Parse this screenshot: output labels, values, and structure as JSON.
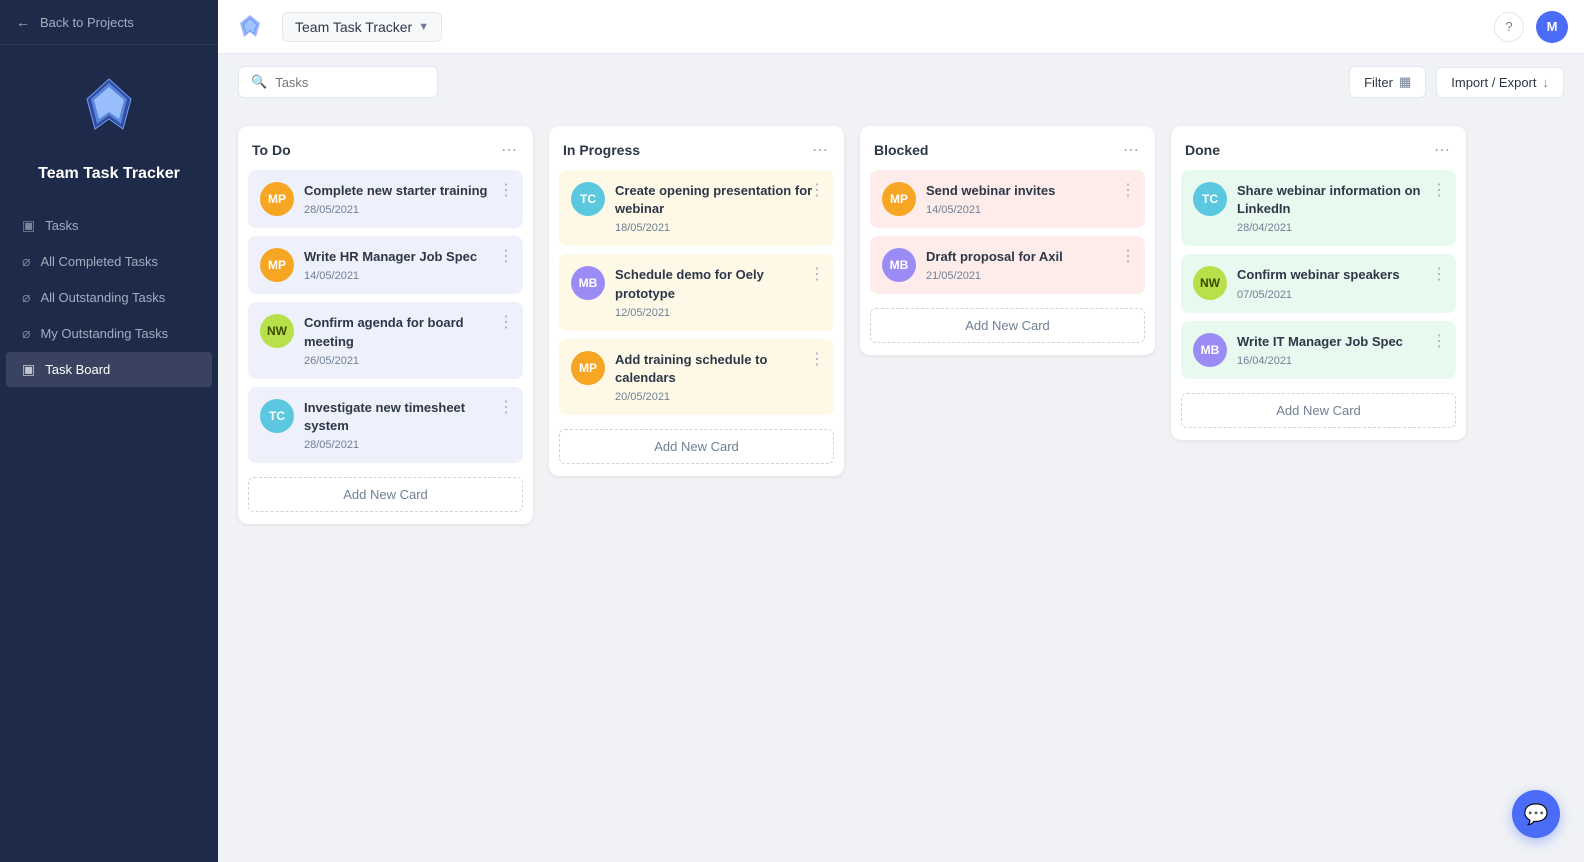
{
  "sidebar": {
    "back_label": "Back to Projects",
    "project_title": "Team Task Tracker",
    "nav_items": [
      {
        "id": "tasks",
        "label": "Tasks",
        "icon": "▦",
        "active": false
      },
      {
        "id": "all-completed",
        "label": "All Completed Tasks",
        "icon": "⌀",
        "active": false
      },
      {
        "id": "all-outstanding",
        "label": "All Outstanding Tasks",
        "icon": "⌀",
        "active": false
      },
      {
        "id": "my-outstanding",
        "label": "My Outstanding Tasks",
        "icon": "⌀",
        "active": false
      },
      {
        "id": "task-board",
        "label": "Task Board",
        "icon": "▦",
        "active": true
      }
    ]
  },
  "topbar": {
    "project_name": "Team Task Tracker",
    "help_label": "?",
    "user_initial": "M",
    "search_placeholder": "Tasks"
  },
  "toolbar": {
    "filter_label": "Filter",
    "import_export_label": "Import / Export"
  },
  "columns": [
    {
      "id": "todo",
      "title": "To Do",
      "theme": "todo",
      "cards": [
        {
          "id": "c1",
          "avatar": "MP",
          "avatar_class": "avatar-mp",
          "title": "Complete new starter training",
          "date": "28/05/2021"
        },
        {
          "id": "c2",
          "avatar": "MP",
          "avatar_class": "avatar-mp",
          "title": "Write HR Manager Job Spec",
          "date": "14/05/2021"
        },
        {
          "id": "c3",
          "avatar": "NW",
          "avatar_class": "avatar-nw",
          "title": "Confirm agenda for board meeting",
          "date": "26/05/2021"
        },
        {
          "id": "c4",
          "avatar": "TC",
          "avatar_class": "avatar-tc",
          "title": "Investigate new timesheet system",
          "date": "28/05/2021"
        }
      ],
      "add_label": "Add New Card"
    },
    {
      "id": "inprogress",
      "title": "In Progress",
      "theme": "inprogress",
      "cards": [
        {
          "id": "c5",
          "avatar": "TC",
          "avatar_class": "avatar-tc",
          "title": "Create opening presentation for webinar",
          "date": "18/05/2021"
        },
        {
          "id": "c6",
          "avatar": "MB",
          "avatar_class": "avatar-mb",
          "title": "Schedule demo for Oely prototype",
          "date": "12/05/2021"
        },
        {
          "id": "c7",
          "avatar": "MP",
          "avatar_class": "avatar-mp",
          "title": "Add training schedule to calendars",
          "date": "20/05/2021"
        }
      ],
      "add_label": "Add New Card"
    },
    {
      "id": "blocked",
      "title": "Blocked",
      "theme": "blocked",
      "cards": [
        {
          "id": "c8",
          "avatar": "MP",
          "avatar_class": "avatar-mp",
          "title": "Send webinar invites",
          "date": "14/05/2021"
        },
        {
          "id": "c9",
          "avatar": "MB",
          "avatar_class": "avatar-mb",
          "title": "Draft proposal for Axil",
          "date": "21/05/2021"
        }
      ],
      "add_label": "Add New Card"
    },
    {
      "id": "done",
      "title": "Done",
      "theme": "done",
      "cards": [
        {
          "id": "c10",
          "avatar": "TC",
          "avatar_class": "avatar-tc",
          "title": "Share webinar information on LinkedIn",
          "date": "28/04/2021"
        },
        {
          "id": "c11",
          "avatar": "NW",
          "avatar_class": "avatar-nw",
          "title": "Confirm webinar speakers",
          "date": "07/05/2021"
        },
        {
          "id": "c12",
          "avatar": "MB",
          "avatar_class": "avatar-mb",
          "title": "Write IT Manager Job Spec",
          "date": "16/04/2021"
        }
      ],
      "add_label": "Add New Card"
    }
  ]
}
